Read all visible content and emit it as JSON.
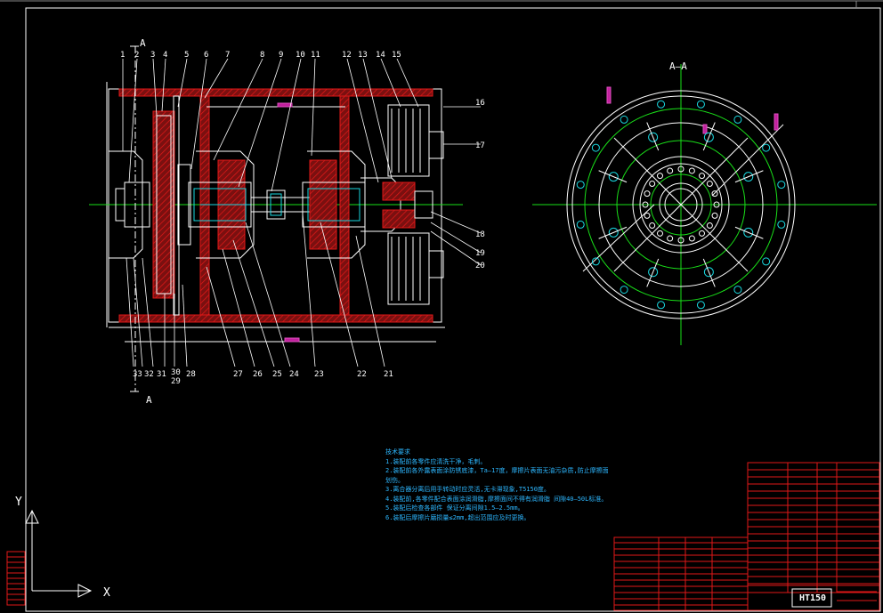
{
  "drawing": {
    "section_mark": "A",
    "section_view_title": "A—A",
    "part_numbers_top": [
      "1",
      "2",
      "3",
      "4",
      "5",
      "6",
      "7",
      "8",
      "9",
      "10",
      "11",
      "12",
      "13",
      "14",
      "15"
    ],
    "part_numbers_right": [
      "16",
      "17",
      "18",
      "19",
      "20"
    ],
    "part_numbers_bottom": [
      "33",
      "32",
      "31",
      "30",
      "29",
      "28",
      "27",
      "26",
      "25",
      "24",
      "23",
      "22",
      "21"
    ],
    "axis_x": "X",
    "axis_y": "Y"
  },
  "notes": {
    "title": "技术要求",
    "lines": [
      "1.装配前各零件应清洗干净，毛刺。",
      "2.装配前各外露表面涂防锈底漆，Ta—17度，摩擦片表面无油污杂质,防止摩擦面受损",
      "   划伤。",
      "3.离合器分离后用手转动时应灵活,无卡滞现象,T5150度。",
      "4.装配前,各零件配合表面涂润滑脂,摩擦面间不得有润滑脂 间隙40—50L标准。",
      "5.装配后检查各部件 保证分离间隙1.5—2.5mm。",
      "6.装配后摩擦片磨损量≤2mm,超出范围应及时更换。"
    ]
  },
  "title_block": {
    "drawing_title": "HT150"
  },
  "colors": {
    "background": "#000000",
    "outline": "#ffffff",
    "centerline": "#19e019",
    "section": "#e01818",
    "hidden": "#19d8e0",
    "notes_text": "#2db7ff"
  }
}
